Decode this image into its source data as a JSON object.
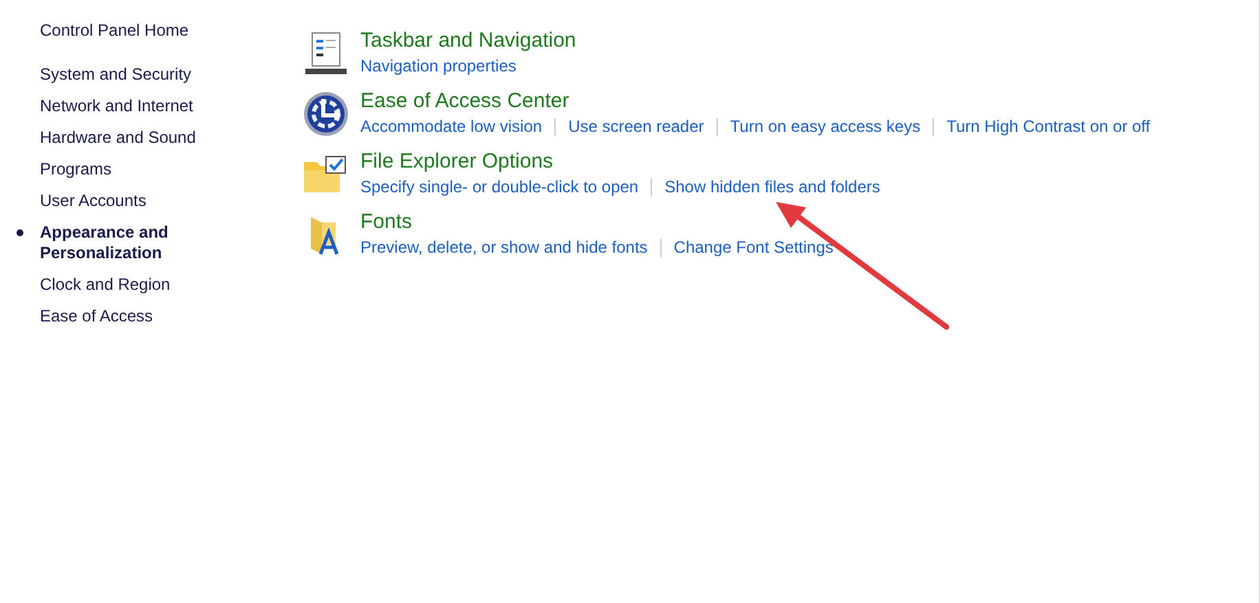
{
  "sidebar": {
    "home": "Control Panel Home",
    "items": [
      {
        "label": "System and Security",
        "selected": false
      },
      {
        "label": "Network and Internet",
        "selected": false
      },
      {
        "label": "Hardware and Sound",
        "selected": false
      },
      {
        "label": "Programs",
        "selected": false
      },
      {
        "label": "User Accounts",
        "selected": false
      },
      {
        "label": "Appearance and Personalization",
        "selected": true
      },
      {
        "label": "Clock and Region",
        "selected": false
      },
      {
        "label": "Ease of Access",
        "selected": false
      }
    ]
  },
  "sections": [
    {
      "kind": "taskbar",
      "title": "Taskbar and Navigation",
      "links": [
        "Navigation properties"
      ]
    },
    {
      "kind": "ease",
      "title": "Ease of Access Center",
      "links": [
        "Accommodate low vision",
        "Use screen reader",
        "Turn on easy access keys",
        "Turn High Contrast on or off"
      ]
    },
    {
      "kind": "folder",
      "title": "File Explorer Options",
      "links": [
        "Specify single- or double-click to open",
        "Show hidden files and folders"
      ]
    },
    {
      "kind": "fonts",
      "title": "Fonts",
      "links": [
        "Preview, delete, or show and hide fonts",
        "Change Font Settings"
      ]
    }
  ]
}
